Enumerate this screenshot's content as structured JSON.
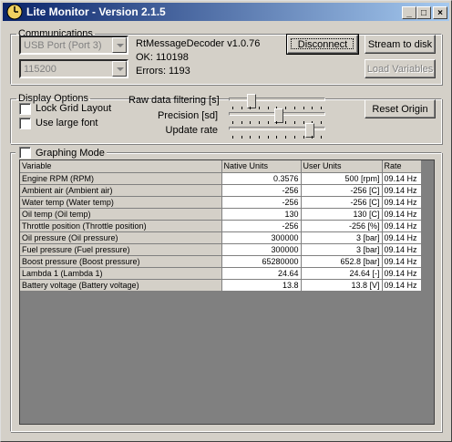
{
  "window": {
    "title": "Lite Monitor - Version 2.1.5",
    "icon": "clock-icon"
  },
  "communications": {
    "legend": "Communications",
    "port": "USB Port (Port 3)",
    "baud": "115200",
    "decoder": "RtMessageDecoder v1.0.76",
    "ok": "OK: 110198",
    "errors": "Errors: 1193",
    "disconnect_label": "Disconnect",
    "stream_label": "Stream to disk",
    "load_label": "Load Variables"
  },
  "display": {
    "legend": "Display Options",
    "lock_grid": "Lock Grid Layout",
    "large_font": "Use large font",
    "raw_filter_label": "Raw data filtering [s]",
    "precision_label": "Precision [sd]",
    "update_rate_label": "Update rate",
    "raw_filter_level": 0.22,
    "precision_level": 0.52,
    "update_rate_level": 0.86,
    "reset_label": "Reset Origin"
  },
  "graphing": {
    "label": "Graphing Mode"
  },
  "table": {
    "headers": [
      "Variable",
      "Native Units",
      "User Units",
      "Rate"
    ],
    "rows": [
      [
        "Engine RPM (RPM)",
        "0.3576",
        "500 [rpm]",
        "09.14 Hz"
      ],
      [
        "Ambient air (Ambient air)",
        "-256",
        "-256 [C]",
        "09.14 Hz"
      ],
      [
        "Water temp (Water temp)",
        "-256",
        "-256 [C]",
        "09.14 Hz"
      ],
      [
        "Oil temp (Oil temp)",
        "130",
        "130 [C]",
        "09.14 Hz"
      ],
      [
        "Throttle position (Throttle position)",
        "-256",
        "-256 [%]",
        "09.14 Hz"
      ],
      [
        "Oil pressure (Oil pressure)",
        "300000",
        "3 [bar]",
        "09.14 Hz"
      ],
      [
        "Fuel pressure (Fuel pressure)",
        "300000",
        "3 [bar]",
        "09.14 Hz"
      ],
      [
        "Boost pressure (Boost pressure)",
        "65280000",
        "652.8 [bar]",
        "09.14 Hz"
      ],
      [
        "Lambda 1 (Lambda 1)",
        "24.64",
        "24.64 [-]",
        "09.14 Hz"
      ],
      [
        "Battery voltage (Battery voltage)",
        "13.8",
        "13.8 [V]",
        "09.14 Hz"
      ]
    ]
  }
}
